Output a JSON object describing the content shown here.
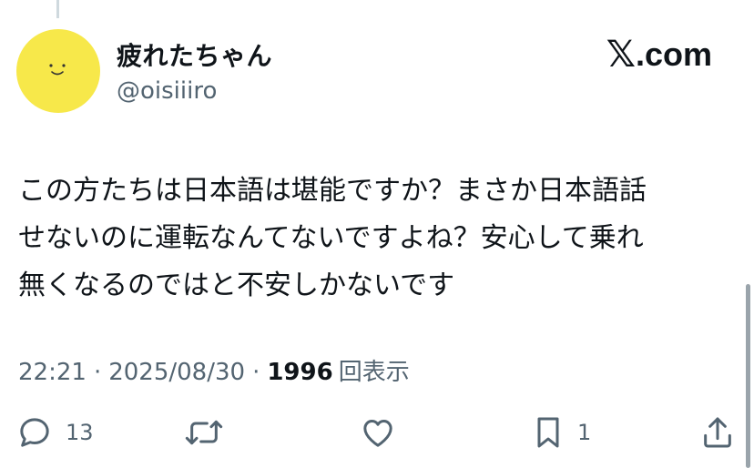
{
  "author": {
    "display_name": "疲れたちゃん",
    "handle": "@oisiiiro"
  },
  "brand": {
    "x_glyph": "𝕏",
    "domain": ".com"
  },
  "tweet": {
    "lines": [
      "この方たちは日本語は堪能ですか？まさか日本語話",
      "せないのに運転なんてないですよね？安心して乗れ",
      "無くなるのではと不安しかないです"
    ]
  },
  "meta": {
    "time": "22:21",
    "separator": "·",
    "date": "2025/08/30",
    "views_count": "1996",
    "views_label": "回表示"
  },
  "actions": {
    "reply_count": "13",
    "bookmark_count": "1"
  },
  "colors": {
    "avatar": "#f7e84a",
    "muted_text": "#536471",
    "primary_text": "#0f1419"
  }
}
